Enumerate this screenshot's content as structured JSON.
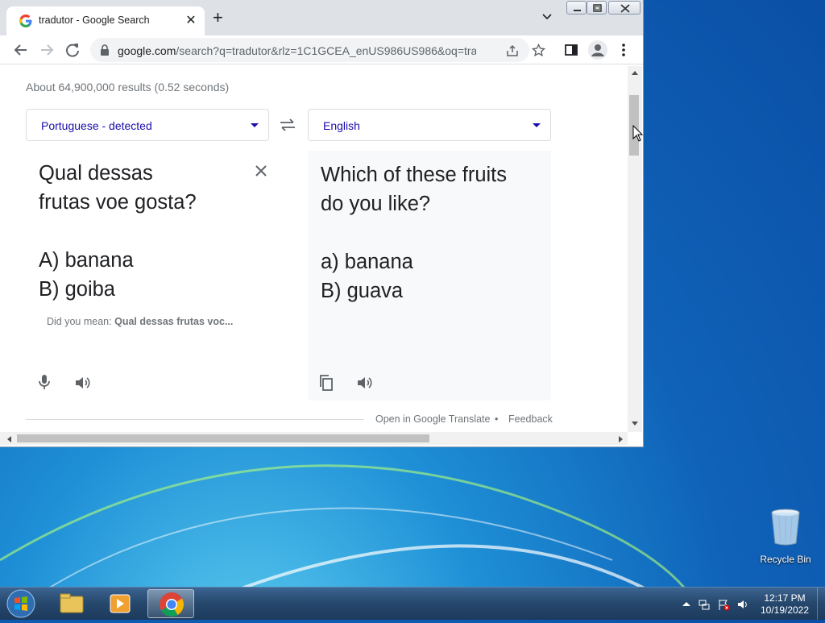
{
  "browser": {
    "tab_title": "tradutor - Google Search",
    "url_host": "google.com",
    "url_rest": "/search?q=tradutor&rlz=1C1GCEA_enUS986US986&oq=tradut..."
  },
  "results": {
    "stats": "About 64,900,000 results (0.52 seconds)"
  },
  "translate": {
    "source_lang": "Portuguese - detected",
    "target_lang": "English",
    "source_text": "Qual dessas\nfrutas voe gosta?\n\nA) banana\nB) goiba",
    "target_text": "Which of these fruits\ndo you like?\n\na) banana\nB) guava",
    "did_you_mean_label": "Did you mean:",
    "did_you_mean_value": "Qual dessas frutas voc...",
    "open_link": "Open in Google Translate",
    "separator": "•",
    "feedback": "Feedback"
  },
  "desktop": {
    "recycle_bin": "Recycle Bin"
  },
  "taskbar": {
    "time": "12:17 PM",
    "date": "10/19/2022"
  },
  "colors": {
    "link_blue": "#1a0dab",
    "chrome_tabstrip": "#dee1e6",
    "taskbar": "#27496e"
  }
}
